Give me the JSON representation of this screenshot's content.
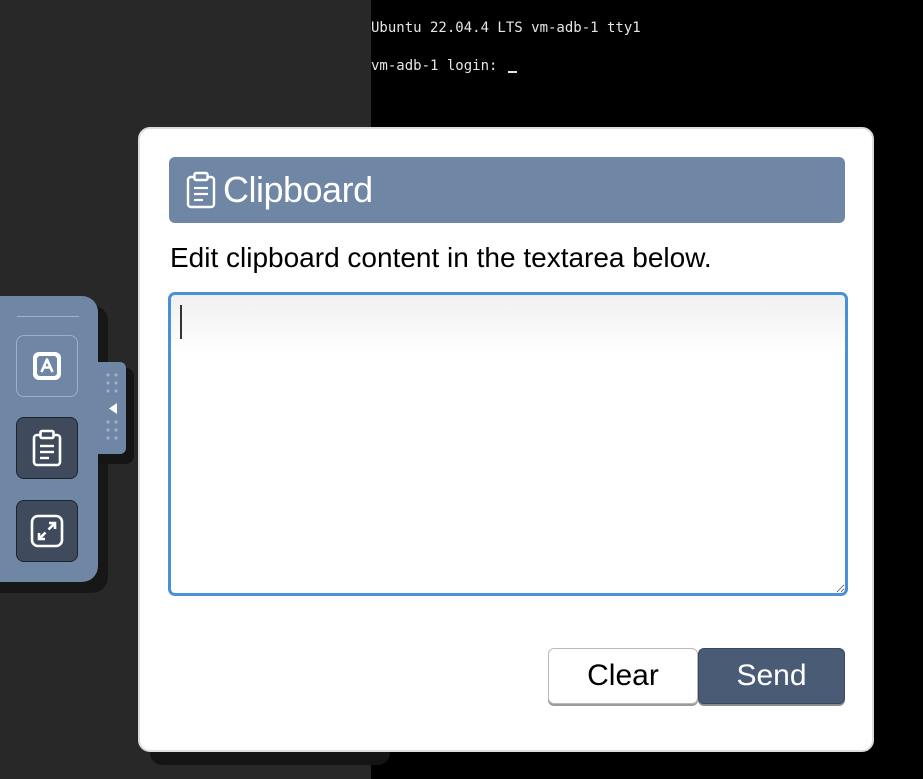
{
  "terminal": {
    "line1": "Ubuntu 22.04.4 LTS vm-adb-1 tty1",
    "line2": "vm-adb-1 login: "
  },
  "control_bar": {
    "buttons": [
      {
        "icon": "keyboard-icon",
        "name": "keyboard-button"
      },
      {
        "icon": "clipboard-icon",
        "name": "clipboard-button"
      },
      {
        "icon": "fullscreen-icon",
        "name": "fullscreen-button"
      }
    ],
    "handle_icon": "collapse-arrow-icon"
  },
  "clipboard_modal": {
    "title": "Clipboard",
    "description": "Edit clipboard content in the textarea below.",
    "textarea_value": "",
    "clear_label": "Clear",
    "send_label": "Send"
  },
  "colors": {
    "accent": "#6f86a4",
    "send_button": "#4a5b75",
    "focus_border": "#4a90d9",
    "terminal_bg": "#000000",
    "page_bg": "#282828"
  }
}
